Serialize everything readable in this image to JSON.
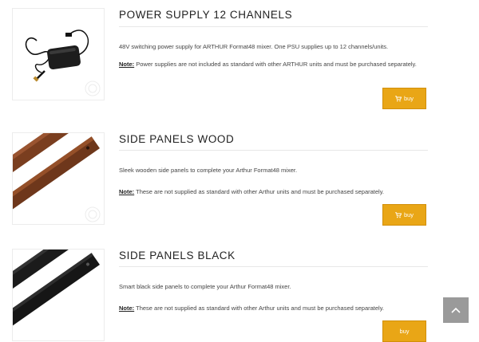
{
  "products": [
    {
      "title": "POWER SUPPLY 12 CHANNELS",
      "description": "48V switching power supply for ARTHUR Format48 mixer. One PSU supplies up to 12 channels/units.",
      "note_label": "Note:",
      "note_text": " Power supplies are not included as standard with other ARTHUR units and must be purchased separately.",
      "buy_label": "buy",
      "image": "power-supply-adapter"
    },
    {
      "title": "SIDE PANELS WOOD",
      "description": "Sleek wooden side panels to complete your Arthur Format48 mixer.",
      "note_label": "Note:",
      "note_text": " These are not supplied as standard with other Arthur units and must be purchased separately.",
      "buy_label": "buy",
      "image": "wooden-side-panels"
    },
    {
      "title": "SIDE PANELS BLACK",
      "description": "Smart black side panels to complete your Arthur Format48 mixer.",
      "note_label": "Note:",
      "note_text": " These are not supplied as standard with other Arthur units and must be purchased separately.",
      "buy_label": "buy",
      "image": "black-side-panels"
    }
  ],
  "icons": {
    "cart": "shopping-cart-icon",
    "scroll_top": "chevron-up-icon"
  },
  "colors": {
    "buy_button": "#e9a616",
    "scroll_top_button": "#9a9a9a",
    "wood": "#7a3e1f",
    "black_panel": "#1b1b1b"
  }
}
